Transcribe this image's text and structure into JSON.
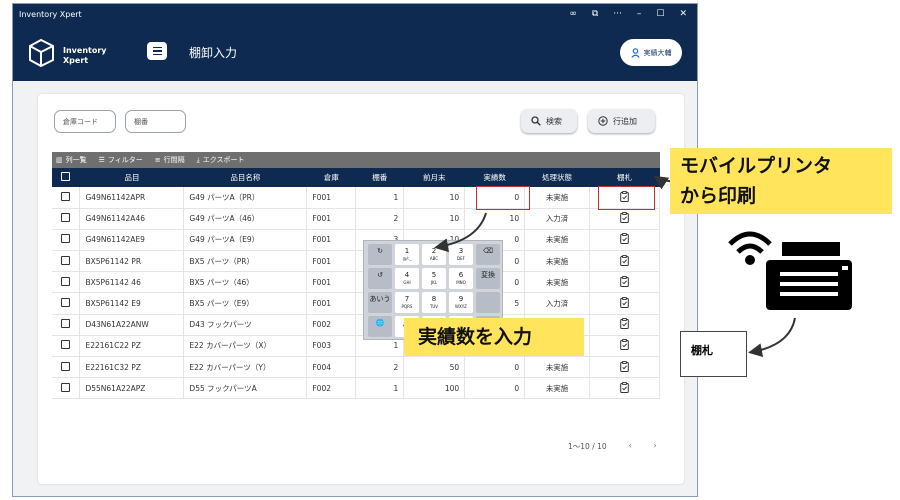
{
  "window": {
    "title": "Inventory Xpert",
    "controls": [
      "∞",
      "⧉",
      "···",
      "–",
      "☐",
      "✕"
    ]
  },
  "app": {
    "logo_line1": "Inventory",
    "logo_line2": "Xpert",
    "page_title": "棚卸入力",
    "user_label": "実績大輔"
  },
  "filters": {
    "warehouse_placeholder": "倉庫コード",
    "shelf_placeholder": "棚番"
  },
  "buttons": {
    "search": "検索",
    "add_row": "行追加"
  },
  "toolbar": {
    "columns": "列一覧",
    "filter": "フィルター",
    "density": "行間隔",
    "export": "エクスポート"
  },
  "table": {
    "headers": [
      "品目",
      "品目名称",
      "倉庫",
      "棚番",
      "前月末",
      "実績数",
      "処理状態",
      "棚札"
    ],
    "rows": [
      {
        "item": "G49N61142APR",
        "name": "G49 パーツA（PR）",
        "wh": "F001",
        "shelf": "1",
        "prev": "10",
        "actual": "0",
        "status": "未実施"
      },
      {
        "item": "G49N61142A46",
        "name": "G49 パーツA（46）",
        "wh": "F001",
        "shelf": "2",
        "prev": "10",
        "actual": "10",
        "status": "入力済"
      },
      {
        "item": "G49N61142AE9",
        "name": "G49 パーツA（E9）",
        "wh": "F001",
        "shelf": "3",
        "prev": "10",
        "actual": "0",
        "status": "未実施"
      },
      {
        "item": "BX5P61142 PR",
        "name": "BX5 パーツ（PR）",
        "wh": "F001",
        "shelf": "",
        "prev": "",
        "actual": "0",
        "status": "未実施"
      },
      {
        "item": "BX5P61142 46",
        "name": "BX5 パーツ（46）",
        "wh": "F001",
        "shelf": "",
        "prev": "",
        "actual": "0",
        "status": "未実施"
      },
      {
        "item": "BX5P61142 E9",
        "name": "BX5 パーツ（E9）",
        "wh": "F001",
        "shelf": "",
        "prev": "",
        "actual": "5",
        "status": "入力済"
      },
      {
        "item": "D43N61A22ANW",
        "name": "D43 フックパーツ",
        "wh": "F002",
        "shelf": "",
        "prev": "",
        "actual": "",
        "status": ""
      },
      {
        "item": "E22161C22 PZ",
        "name": "E22 カバーパーツ（X）",
        "wh": "F003",
        "shelf": "1",
        "prev": "",
        "actual": "",
        "status": ""
      },
      {
        "item": "E22161C32 PZ",
        "name": "E22 カバーパーツ（Y）",
        "wh": "F004",
        "shelf": "2",
        "prev": "50",
        "actual": "0",
        "status": "未実施"
      },
      {
        "item": "D55N61A22APZ",
        "name": "D55 フックパーツA",
        "wh": "F002",
        "shelf": "1",
        "prev": "100",
        "actual": "0",
        "status": "未実施"
      }
    ]
  },
  "pager": {
    "range": "1～10 / 10",
    "prev": "‹",
    "next": "›"
  },
  "keypad": {
    "keys": [
      {
        "label": "↻",
        "sub": ""
      },
      {
        "label": "1",
        "sub": "@/:_"
      },
      {
        "label": "2",
        "sub": "ABC"
      },
      {
        "label": "3",
        "sub": "DEF"
      },
      {
        "label": "⌫",
        "sub": ""
      },
      {
        "label": "↺",
        "sub": ""
      },
      {
        "label": "4",
        "sub": "GHI"
      },
      {
        "label": "5",
        "sub": "JKL"
      },
      {
        "label": "6",
        "sub": "MNO"
      },
      {
        "label": "変換",
        "sub": ""
      },
      {
        "label": "あいう",
        "sub": ""
      },
      {
        "label": "7",
        "sub": "PQRS"
      },
      {
        "label": "8",
        "sub": "TUV"
      },
      {
        "label": "9",
        "sub": "WXYZ"
      },
      {
        "label": "",
        "sub": ""
      },
      {
        "label": "🌐",
        "sub": ""
      },
      {
        "label": "🎤",
        "sub": ""
      },
      {
        "label": "",
        "sub": ""
      },
      {
        "label": "",
        "sub": ""
      },
      {
        "label": "",
        "sub": ""
      }
    ]
  },
  "annotations": {
    "print_line1": "モバイルプリンタ",
    "print_line2": "から印刷",
    "input_label": "実績数を入力",
    "shelf_tag": "棚札"
  },
  "colors": {
    "navy": "#0e2a50",
    "callout": "#ffe45c",
    "highlight": "#c9302c"
  }
}
